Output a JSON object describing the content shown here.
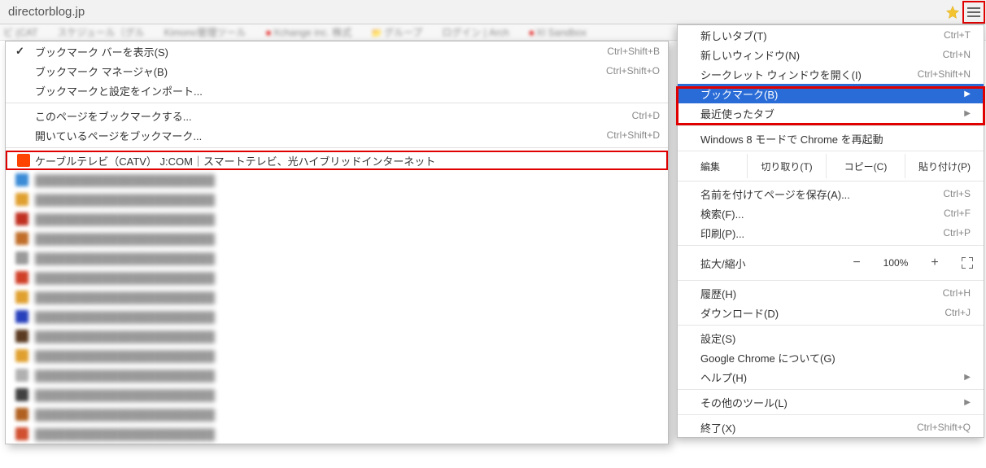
{
  "address_url": "directorblog.jp",
  "bookmarks_toolbar": [
    {
      "label": "ビ (CAT"
    },
    {
      "label": "スケジュール（グル"
    },
    {
      "label": "Kimono管理ツール"
    },
    {
      "label": "Xchange inc. 株式"
    },
    {
      "label": "グループ"
    },
    {
      "label": "ログイン | Arch"
    },
    {
      "label": "XI Sandbox"
    }
  ],
  "bm_submenu_items": [
    {
      "label": "ブックマーク バーを表示(S)",
      "shortcut": "Ctrl+Shift+B",
      "check": true
    },
    {
      "label": "ブックマーク マネージャ(B)",
      "shortcut": "Ctrl+Shift+O"
    },
    {
      "label": "ブックマークと設定をインポート..."
    },
    {
      "sep": true
    },
    {
      "label": "このページをブックマークする...",
      "shortcut": "Ctrl+D"
    },
    {
      "label": "開いているページをブックマーク...",
      "shortcut": "Ctrl+Shift+D"
    },
    {
      "sep": true
    },
    {
      "label": "ケーブルテレビ（CATV）  J:COM｜スマートテレビ、光ハイブリッドインターネット",
      "highbox": true,
      "favcolor": "#ff4400"
    },
    {
      "dim": true,
      "favcolor": "#3b8bd6"
    },
    {
      "dim": true,
      "favcolor": "#e0a030"
    },
    {
      "dim": true,
      "favcolor": "#c03020"
    },
    {
      "dim": true,
      "favcolor": "#c06e2a"
    },
    {
      "dim": true,
      "favcolor": "#9a9a9a"
    },
    {
      "dim": true,
      "favcolor": "#d04028"
    },
    {
      "dim": true,
      "favcolor": "#e0a030"
    },
    {
      "dim": true,
      "favcolor": "#2740bb"
    },
    {
      "dim": true,
      "favcolor": "#5a3a20"
    },
    {
      "dim": true,
      "favcolor": "#e0a030"
    },
    {
      "dim": true,
      "favcolor": "#b0b0b0"
    },
    {
      "dim": true,
      "favcolor": "#404040"
    },
    {
      "dim": true,
      "favcolor": "#b06020"
    },
    {
      "dim": true,
      "favcolor": "#d05030"
    }
  ],
  "main_menu": {
    "new_tab": {
      "label": "新しいタブ(T)",
      "shortcut": "Ctrl+T"
    },
    "new_window": {
      "label": "新しいウィンドウ(N)",
      "shortcut": "Ctrl+N"
    },
    "incognito": {
      "label": "シークレット ウィンドウを開く(I)",
      "shortcut": "Ctrl+Shift+N"
    },
    "bookmarks": {
      "label": "ブックマーク(B)"
    },
    "recent_tabs": {
      "label": "最近使ったタブ"
    },
    "win8": {
      "label": "Windows 8 モードで Chrome を再起動"
    },
    "edit_lbl": "編集",
    "cut": "切り取り(T)",
    "copy": "コピー(C)",
    "paste": "貼り付け(P)",
    "save_as": {
      "label": "名前を付けてページを保存(A)...",
      "shortcut": "Ctrl+S"
    },
    "find": {
      "label": "検索(F)...",
      "shortcut": "Ctrl+F"
    },
    "print": {
      "label": "印刷(P)...",
      "shortcut": "Ctrl+P"
    },
    "zoom_lbl": "拡大/縮小",
    "zoom_pct": "100%",
    "history": {
      "label": "履歴(H)",
      "shortcut": "Ctrl+H"
    },
    "downloads": {
      "label": "ダウンロード(D)",
      "shortcut": "Ctrl+J"
    },
    "settings": {
      "label": "設定(S)"
    },
    "about": {
      "label": "Google Chrome について(G)"
    },
    "help": {
      "label": "ヘルプ(H)"
    },
    "more_tools": {
      "label": "その他のツール(L)"
    },
    "exit": {
      "label": "終了(X)",
      "shortcut": "Ctrl+Shift+Q"
    }
  }
}
